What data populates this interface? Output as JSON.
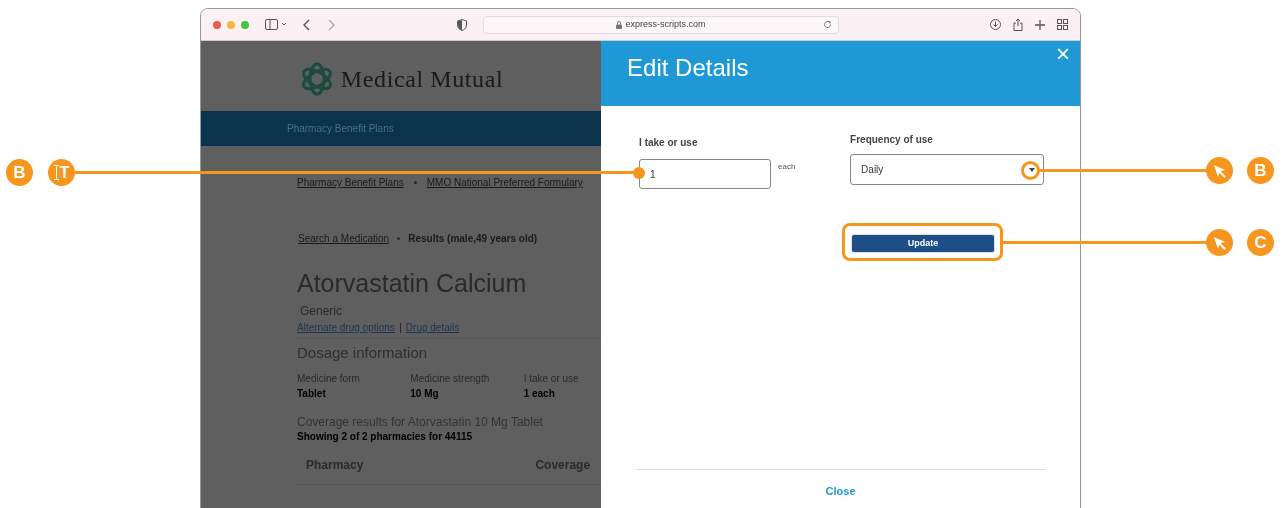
{
  "browser": {
    "url": "express-scripts.com"
  },
  "background_page": {
    "logo": "Medical Mutual",
    "nav_item": "Pharmacy Benefit Plans",
    "breadcrumb": [
      "Pharmacy Benefit Plans",
      "MMO National Preferred Formulary"
    ],
    "results_breadcrumb": {
      "link": "Search a Medication",
      "current": "Results (male,49 years old)"
    },
    "drug_name": "Atorvastatin Calcium",
    "drug_type": "Generic",
    "links": [
      "Alternate drug options",
      "Drug details"
    ],
    "section_title": "Dosage information",
    "dosage_fields": [
      {
        "label": "Medicine form",
        "value": "Tablet"
      },
      {
        "label": "Medicine strength",
        "value": "10 Mg"
      },
      {
        "label": "I take or use",
        "value": "1 each"
      }
    ],
    "coverage_title": "Coverage results for Atorvastatin 10 Mg Tablet",
    "coverage_count": "Showing 2 of 2 pharmacies for 44115",
    "table": {
      "columns": [
        "Pharmacy",
        "Coverage"
      ]
    }
  },
  "modal": {
    "title": "Edit Details",
    "close_icon": "×",
    "quantity": {
      "label": "I take or use",
      "value": "1",
      "unit": "each"
    },
    "frequency": {
      "label": "Frequency of use",
      "value": "Daily"
    },
    "update_button": "Update",
    "close_button": "Close"
  },
  "annotations": [
    {
      "label": "B",
      "kind": "text",
      "cursor_label": "T"
    },
    {
      "label": "B",
      "kind": "pointer"
    },
    {
      "label": "C",
      "kind": "pointer"
    }
  ]
}
